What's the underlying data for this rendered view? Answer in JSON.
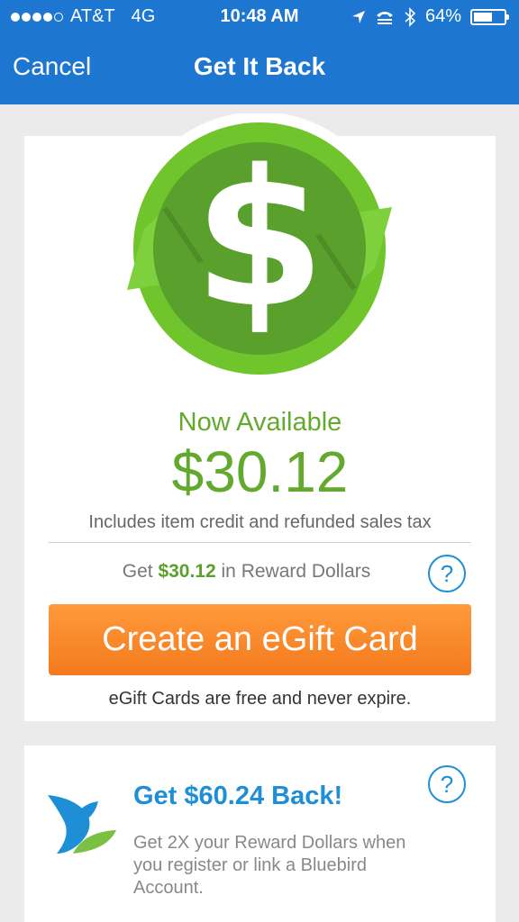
{
  "status_bar": {
    "signal_filled": 4,
    "signal_total": 5,
    "carrier": "AT&T",
    "network": "4G",
    "time": "10:48 AM",
    "battery_percent": "64%",
    "battery_level": 0.64
  },
  "nav": {
    "cancel_label": "Cancel",
    "title": "Get It Back"
  },
  "summary": {
    "status_label": "Now Available",
    "amount": "$30.12",
    "includes_note": "Includes item credit and refunded sales tax",
    "reward_prefix": "Get",
    "reward_amount": "$30.12",
    "reward_suffix": "in Reward Dollars",
    "help_label": "?",
    "egift_button_label": "Create an eGift Card",
    "egift_note": "eGift Cards are free and never expire."
  },
  "promo": {
    "title": "Get $60.24 Back!",
    "description": "Get 2X your Reward Dollars when you register or link a Bluebird Account.",
    "help_label": "?"
  },
  "colors": {
    "nav_blue": "#1d77d0",
    "green": "#63a92d",
    "orange": "#f37a1d",
    "link_blue": "#1e8fd6"
  }
}
